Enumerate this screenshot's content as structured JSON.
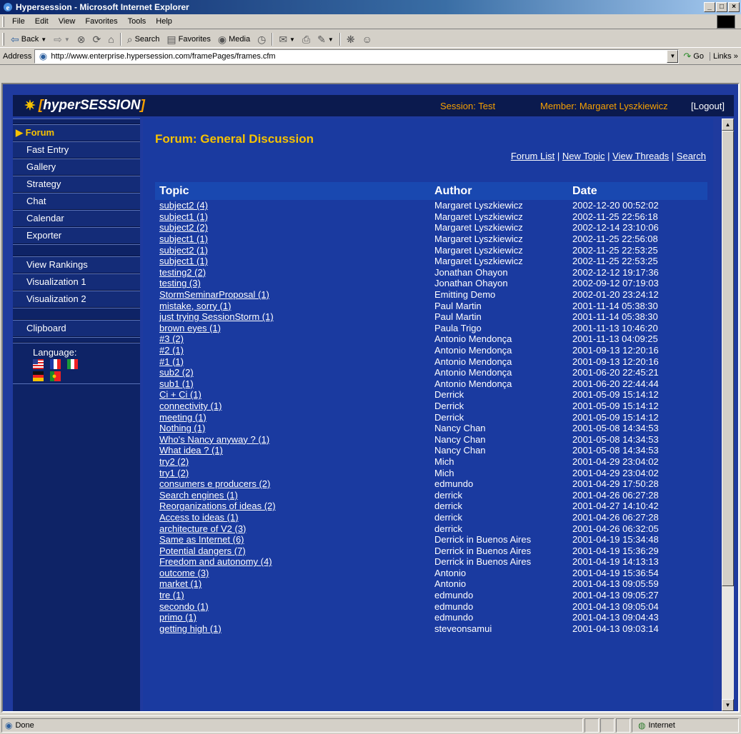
{
  "browser": {
    "title": "Hypersession - Microsoft Internet Explorer",
    "window_buttons": [
      "_",
      "□",
      "×"
    ],
    "menu": [
      "File",
      "Edit",
      "View",
      "Favorites",
      "Tools",
      "Help"
    ],
    "toolbar": {
      "back": "Back",
      "search": "Search",
      "favorites": "Favorites",
      "media": "Media"
    },
    "address_label": "Address",
    "url": "http://www.enterprise.hypersession.com/framePages/frames.cfm",
    "go": "Go",
    "links": "Links »"
  },
  "header": {
    "logo_star": "✷",
    "logo_open": "[",
    "logo_text": "hyperSESSION",
    "logo_close": "]",
    "session": "Session: Test",
    "member": "Member: Margaret Lyszkiewicz",
    "logout": "[Logout]"
  },
  "sidebar": {
    "active_marker": "▶",
    "items": [
      "Forum",
      "Fast Entry",
      "Gallery",
      "Strategy",
      "Chat",
      "Calendar",
      "Exporter"
    ],
    "items2": [
      "View Rankings",
      "Visualization 1",
      "Visualization 2"
    ],
    "items3": [
      "Clipboard"
    ],
    "language_label": "Language:"
  },
  "forum": {
    "title": "Forum: General Discussion",
    "links": [
      "Forum List",
      "New Topic",
      "View Threads",
      "Search"
    ],
    "separator": " | ",
    "columns": [
      "Topic",
      "Author",
      "Date"
    ],
    "rows": [
      [
        "subject2 (4)",
        "Margaret Lyszkiewicz",
        "2002-12-20 00:52:02"
      ],
      [
        "subject1 (1)",
        "Margaret Lyszkiewicz",
        "2002-11-25 22:56:18"
      ],
      [
        "subject2 (2)",
        "Margaret Lyszkiewicz",
        "2002-12-14 23:10:06"
      ],
      [
        "subject1 (1)",
        "Margaret Lyszkiewicz",
        "2002-11-25 22:56:08"
      ],
      [
        "subject2 (1)",
        "Margaret Lyszkiewicz",
        "2002-11-25 22:53:25"
      ],
      [
        "subject1 (1)",
        "Margaret Lyszkiewicz",
        "2002-11-25 22:53:25"
      ],
      [
        "testing2 (2)",
        "Jonathan Ohayon",
        "2002-12-12 19:17:36"
      ],
      [
        "testing (3)",
        "Jonathan Ohayon",
        "2002-09-12 07:19:03"
      ],
      [
        "StormSeminarProposal (1)",
        "Emitting Demo",
        "2002-01-20 23:24:12"
      ],
      [
        "mistake, sorry (1)",
        "Paul Martin",
        "2001-11-14 05:38:30"
      ],
      [
        "just trying SessionStorm (1)",
        "Paul Martin",
        "2001-11-14 05:38:30"
      ],
      [
        "brown eyes (1)",
        "Paula Trigo",
        "2001-11-13 10:46:20"
      ],
      [
        "#3 (2)",
        "Antonio Mendonça",
        "2001-11-13 04:09:25"
      ],
      [
        "#2 (1)",
        "Antonio Mendonça",
        "2001-09-13 12:20:16"
      ],
      [
        "#1 (1)",
        "Antonio Mendonça",
        "2001-09-13 12:20:16"
      ],
      [
        "sub2 (2)",
        "Antonio Mendonça",
        "2001-06-20 22:45:21"
      ],
      [
        "sub1 (1)",
        "Antonio Mendonça",
        "2001-06-20 22:44:44"
      ],
      [
        "Ci + Ci (1)",
        "Derrick",
        "2001-05-09 15:14:12"
      ],
      [
        "connectivity (1)",
        "Derrick",
        "2001-05-09 15:14:12"
      ],
      [
        "meeting (1)",
        "Derrick",
        "2001-05-09 15:14:12"
      ],
      [
        "Nothing (1)",
        "Nancy Chan",
        "2001-05-08 14:34:53"
      ],
      [
        "Who's Nancy anyway ? (1)",
        "Nancy Chan",
        "2001-05-08 14:34:53"
      ],
      [
        "What idea ? (1)",
        "Nancy Chan",
        "2001-05-08 14:34:53"
      ],
      [
        "try2 (2)",
        "Mich",
        "2001-04-29 23:04:02"
      ],
      [
        "try1 (2)",
        "Mich",
        "2001-04-29 23:04:02"
      ],
      [
        "consumers e producers (2)",
        "edmundo",
        "2001-04-29 17:50:28"
      ],
      [
        "Search engines (1)",
        "derrick",
        "2001-04-26 06:27:28"
      ],
      [
        "Reorganizations of ideas (2)",
        "derrick",
        "2001-04-27 14:10:42"
      ],
      [
        "Access to ideas (1)",
        "derrick",
        "2001-04-26 06:27:28"
      ],
      [
        "architecture of V2 (3)",
        "derrick",
        "2001-04-26 06:32:05"
      ],
      [
        "Same as Internet (6)",
        "Derrick in Buenos Aires",
        "2001-04-19 15:34:48"
      ],
      [
        "Potential dangers (7)",
        "Derrick in Buenos Aires",
        "2001-04-19 15:36:29"
      ],
      [
        "Freedom and autonomy (4)",
        "Derrick in Buenos Aires",
        "2001-04-19 14:13:13"
      ],
      [
        "outcome (3)",
        "Antonio",
        "2001-04-19 15:36:54"
      ],
      [
        "market (1)",
        "Antonio",
        "2001-04-13 09:05:59"
      ],
      [
        "tre (1)",
        "edmundo",
        "2001-04-13 09:05:27"
      ],
      [
        "secondo (1)",
        "edmundo",
        "2001-04-13 09:05:04"
      ],
      [
        "primo (1)",
        "edmundo",
        "2001-04-13 09:04:43"
      ],
      [
        "getting high (1)",
        "steveonsamui",
        "2001-04-13 09:03:14"
      ]
    ]
  },
  "status": {
    "left": "Done",
    "zone": "Internet"
  }
}
